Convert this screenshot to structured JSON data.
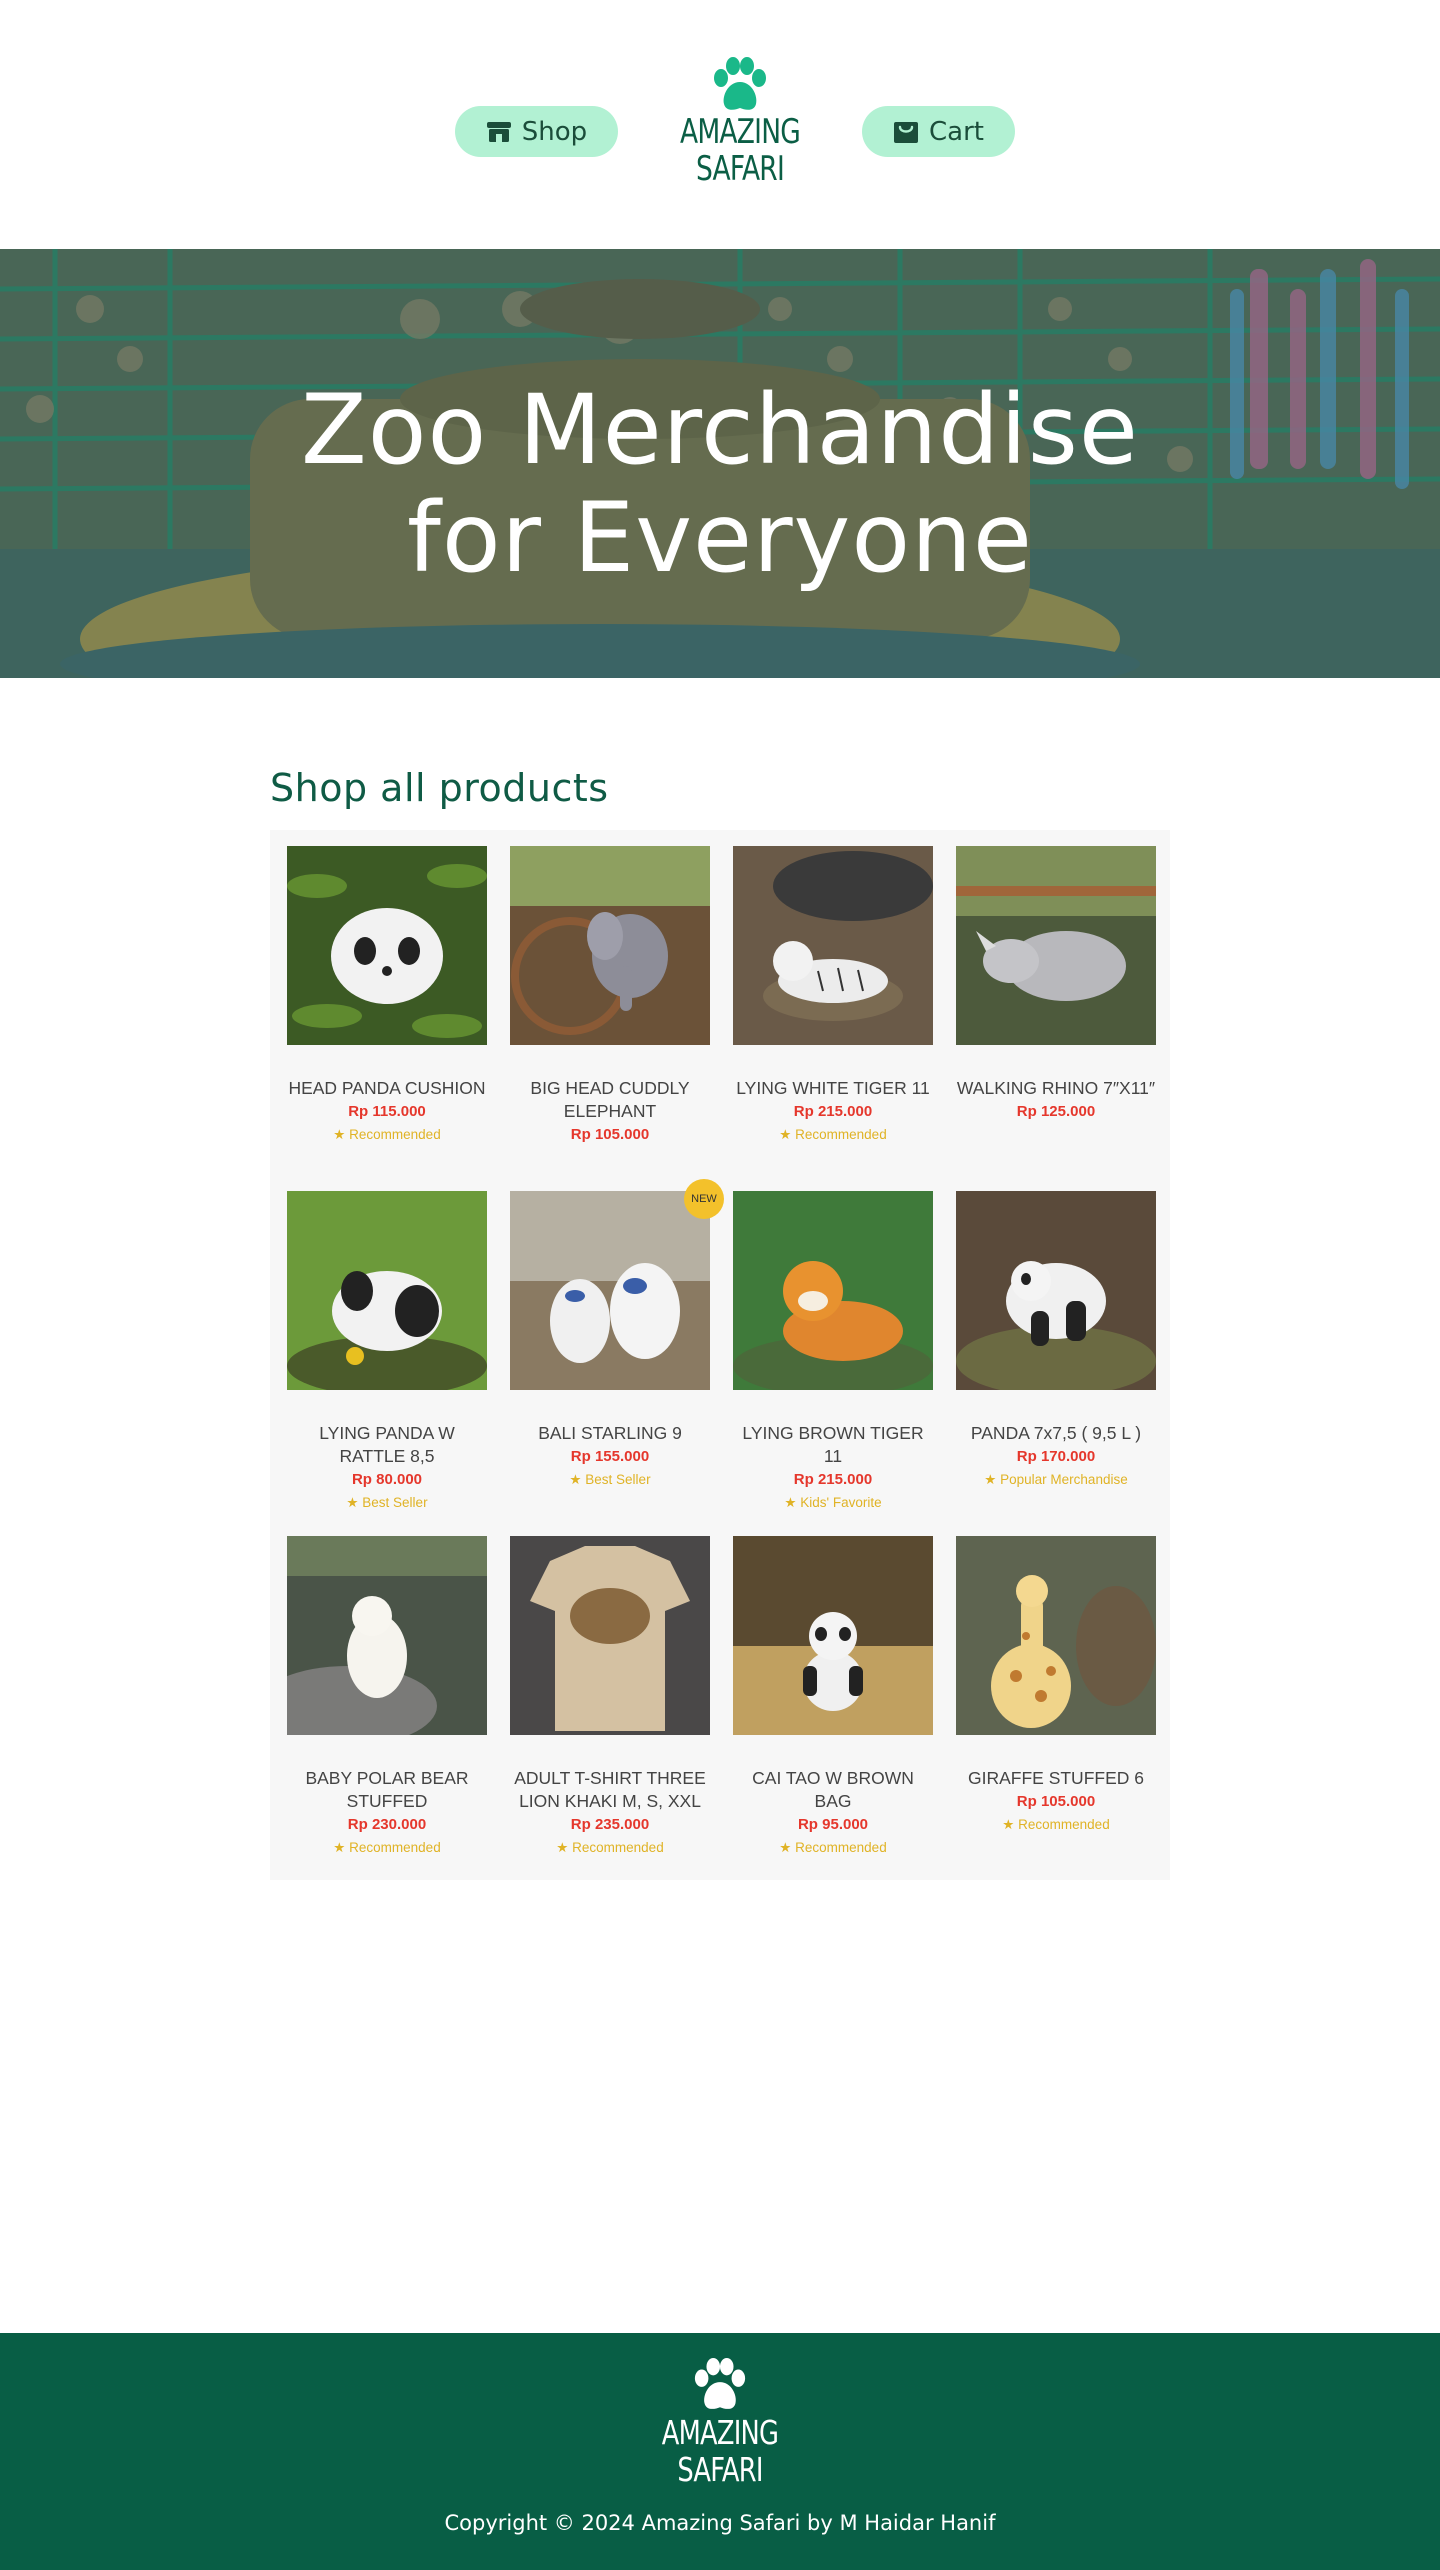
{
  "header": {
    "shop_label": "Shop",
    "cart_label": "Cart",
    "logo_line1": "AMAZING",
    "logo_line2": "SAFARI"
  },
  "hero": {
    "line1": "Zoo Merchandise",
    "line2": "for Everyone"
  },
  "products": {
    "title": "Shop all products",
    "items": [
      {
        "name": "HEAD PANDA CUSHION",
        "price": "Rp 115.000",
        "tag": "Recommended"
      },
      {
        "name": "BIG HEAD CUDDLY ELEPHANT",
        "price": "Rp 105.000",
        "tag": ""
      },
      {
        "name": "LYING WHITE TIGER 11",
        "price": "Rp 215.000",
        "tag": "Recommended"
      },
      {
        "name": "WALKING RHINO 7″X11″",
        "price": "Rp 125.000",
        "tag": ""
      },
      {
        "name": "LYING PANDA W RATTLE 8,5",
        "price": "Rp 80.000",
        "tag": "Best Seller"
      },
      {
        "name": "BALI STARLING 9",
        "price": "Rp 155.000",
        "tag": "Best Seller",
        "badge": "NEW"
      },
      {
        "name": "LYING BROWN TIGER 11",
        "price": "Rp 215.000",
        "tag": "Kids' Favorite"
      },
      {
        "name": "PANDA 7x7,5 ( 9,5 L )",
        "price": "Rp 170.000",
        "tag": "Popular Merchandise"
      },
      {
        "name": "BABY POLAR BEAR STUFFED",
        "price": "Rp 230.000",
        "tag": "Recommended"
      },
      {
        "name": "ADULT T-SHIRT THREE LION KHAKI M, S, XXL",
        "price": "Rp 235.000",
        "tag": "Recommended"
      },
      {
        "name": "CAI TAO W BROWN BAG",
        "price": "Rp 95.000",
        "tag": "Recommended"
      },
      {
        "name": "GIRAFFE STUFFED 6",
        "price": "Rp 105.000",
        "tag": "Recommended"
      }
    ]
  },
  "footer": {
    "logo_line1": "AMAZING",
    "logo_line2": "SAFARI",
    "copyright": "Copyright © 2024 Amazing Safari by M Haidar Hanif"
  },
  "colors": {
    "brand_green": "#0b5e45",
    "pill_bg": "#b2f1d3",
    "price_red": "#e5372c",
    "tag_yellow": "#e0b326"
  }
}
